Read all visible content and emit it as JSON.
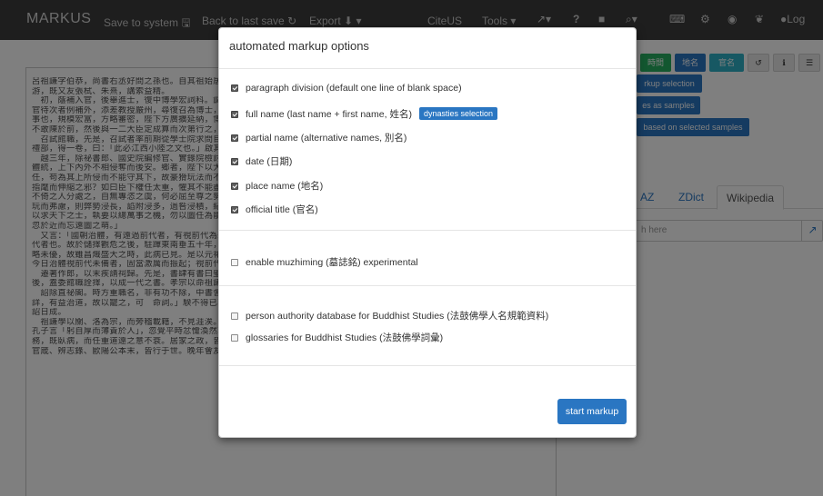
{
  "navbar": {
    "brand": "MARKUS",
    "save": "Save to system",
    "back": "Back to last save",
    "export": "Export",
    "citeus": "CiteUS",
    "tools": "Tools",
    "help": "?",
    "login": "Log"
  },
  "text": {
    "lines": [
      "呂祖謙字伯恭，尚書右丞好問之孫也。自其祖始居婺州。祖謙之學本之家庭，有中原文獻之傳。長從林之奇、汪應辰、胡憲",
      "游，既又友張栻、朱熹，講索益精。",
      "　初，蔭補入官，後舉進士，復中博學宏詞科。調南外宗學教授。以父憂去官，服除，為太學博士，時中兵吳瑩內侍不召，",
      "官待次者例補外，添差教授嚴州，尋復召為博士，兼國史院編修官、實錄院檢討官。輪對，勉孝宗留意聖學。且言：",
      "事也，規模宏富，方略審密，陛下方廣擴延納，博求其故，以資中興之治，而朝廷不與焉。夫不得之於天，則得之於人，",
      "不敢陳於前，然後與一二大臣定成算而次第行之，則大事可成。」",
      "　召試館職，先是，召試者率前期從學士院求問目，獨祖謙不然，而其文特典美。常讀陸宣公奏議，論治體，於是上首問",
      "禮部，得一卷，曰：「此必江西小陸之文也。」啟其名，果九淵，然其學不同也。",
      "　越三年，除祕書郎、國史院編修官、實錄院檢討官。以修撰李燾薦，重修徽宗實錄。書成，進秩。面對，言：「國朝治",
      "體統，上下內外不相侵奪而後安。鄉者，陛下以大臣不勝任而兼任之，以小臣不勝任而侵任之，以外臣不勝任而內任之。",
      "任，苟為其上所侵而不能守其下，故豪猾玩法而不畏，群情不伸而有怨，君子無以自立，小人得以乘間。陛下勵精圖治而",
      "指麾而伸縮之邪？如曰臣下權任太重，懼其不能盡知，則陛下自知之；臣下權任太輕，懼其不能盡任，則陛下自任之。",
      "不倚之人分處之，自無專恣之虞，何必屈至尊之勢而下行有司之事哉？」又言：「今日之事，莫大乎恢復。今陛下",
      "玩而弗慮，則弊勢浸長，諂附浸多，過咎浸積，紀綱浸亂，雖有良法美意，亦不能自行。故臣竊謂陛下當先明大義",
      "以求天下之士，執要以總萬事之機，勿以圖任為能，勿以獨斷為明，勿以自勞為勤，勿以苟安為可，則天下幸甚。」",
      "忽於近而忘遠圖之萌。」",
      "　又言：「國朝治體，有遠過前代者，有視前代為未備者。夫以寬大忠厚建立規模，以禮遜節義成就風俗，此所以遠過",
      "代者也。故於儲擇觀危之後，駐蹕東南垂五十年，本原深固，猶賴於此。至於養兵而兵不精，任官而官不擇，此所以視",
      "略未優，故雖昌熾盛大之時，此病已見。是以元祐初，司馬光、呂公著當國，首議更張，而元豐之法，特因而改之耳。",
      "今日治體視前代未備者，固當激厲而振起；視前代遠過者，尤當愛護而扶持之。」",
      "　遷著作郎，以末疾請祠歸。先是，書肆有書曰聖宋文海，孝宗命臨安府校正刊行。學士周必大言文海去取差謬，恐難",
      "後，盍委館職詮擇，以成一代之書。孝宗以命祖謙。遂斷自中興以前，崇雅黜浮，類為百五十卷，上之，賜名皇朝文鑑。",
      "　詔除直祕閣。時方重職名，非有功不除，中書舍人陳騤駁之。孝宗批旨云：「館閣之職，文史為先。祖謙所編，采取精",
      "詳，有益治道，故以寵之，可　命詞。」騤不得已草制。尋主管沖佑觀。明年，除著作郎兼國史院編修官，以疾辭，",
      "詔日成。",
      "　祖謙學以關、洛為宗，而旁稽載籍，不見涯涘。心平氣和，不立崖異，一時英偉卓犖之士皆歸心焉。少卞急，一日，誦",
      "孔子言「躬自厚而薄責於人」，忽覺平時忿懥渙然冰釋。朱熹嘗言：「學如伯恭，方是能變化氣質。」其所講畫，將以",
      "務，既臥病，而任重道遠之意不衰。居家之政，皆可為後世法。修讀詩記、大事記，皆未成書。考定古周易、書說、閫範、",
      "官箴、辨志錄、歐陽公本末，皆行于世。晚年會友之地曰麗澤書院，在金華城中；既歿，郡人即而祠之。子延年。"
    ]
  },
  "right": {
    "btn_time": "時間",
    "btn_place": "地名",
    "btn_office": "官名",
    "btn_markup_selection": "rkup selection",
    "btn_samples": "es as samples",
    "btn_based": "based on selected samples",
    "tab_caz": "AZ",
    "tab_zdict": "ZDict",
    "tab_wikipedia": "Wikipedia",
    "search_placeholder": "h here"
  },
  "modal": {
    "title": "automated markup options",
    "options": [
      {
        "label": "paragraph division (default one line of blank space)",
        "checked": true
      },
      {
        "label": "full name (last name + first name, 姓名)",
        "checked": true,
        "badge": "dynasties selection"
      },
      {
        "label": "partial name (alternative names, 別名)",
        "checked": true
      },
      {
        "label": "date (日期)",
        "checked": true
      },
      {
        "label": "place name (地名)",
        "checked": true
      },
      {
        "label": "official title (官名)",
        "checked": true
      },
      {
        "label": "enable muzhiming (墓誌銘) experimental",
        "checked": false
      },
      {
        "label": "person authority database for Buddhist Studies (法鼓佛學人名規範資料)",
        "checked": false
      },
      {
        "label": "glossaries for Buddhist Studies (法鼓佛學詞彙)",
        "checked": false
      }
    ],
    "start_button": "start markup"
  },
  "colors": {
    "navbar": "#3c3c3c",
    "primary": "#2a76c2",
    "success": "#27ae60",
    "info": "#2fb0c7"
  }
}
